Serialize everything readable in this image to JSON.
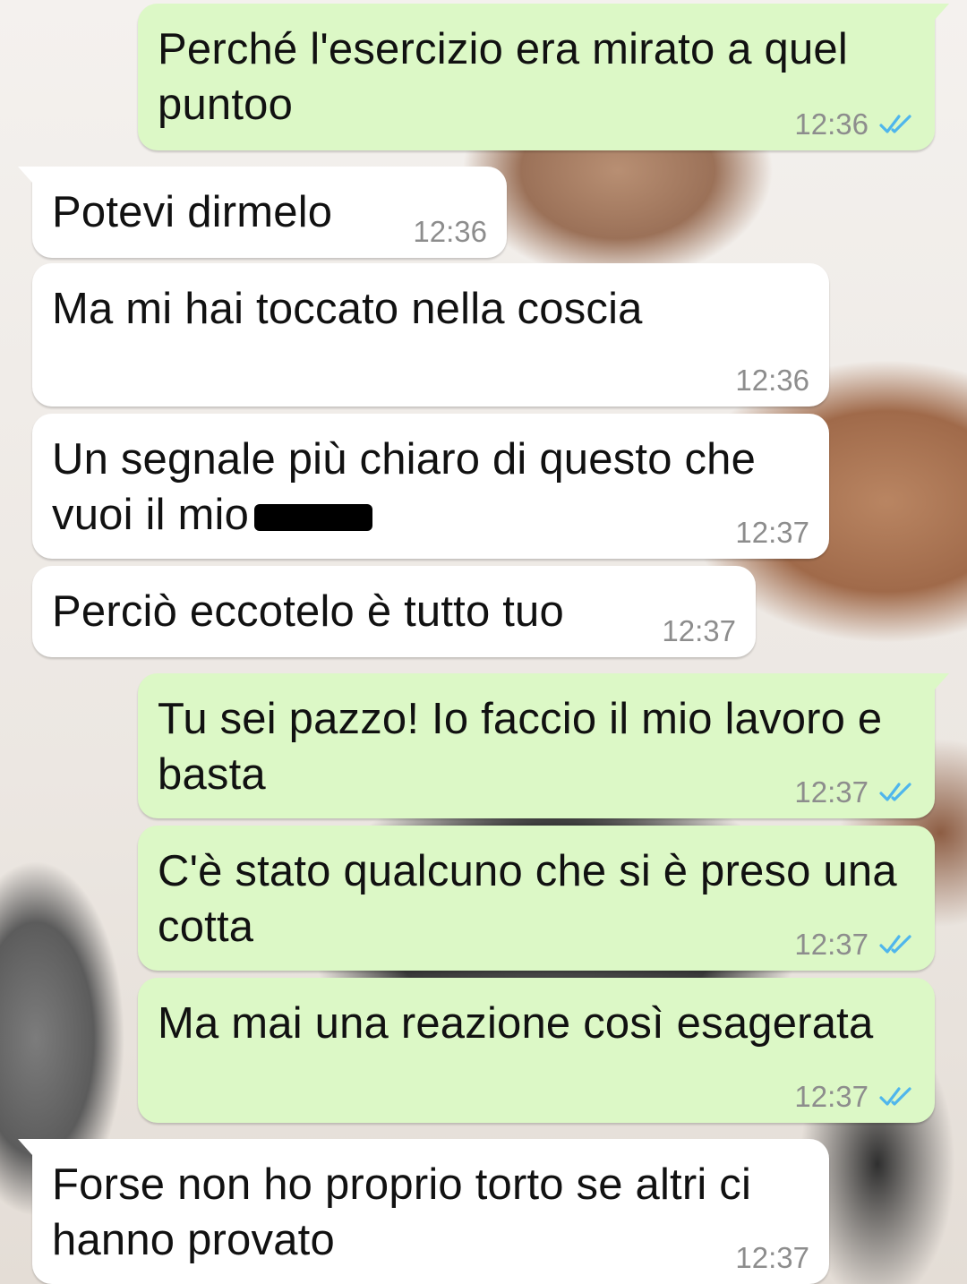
{
  "colors": {
    "incoming_bubble": "#ffffff",
    "outgoing_bubble": "#dcf8c6",
    "time_text": "#8d8d8d",
    "read_ticks": "#4fb6ec"
  },
  "icons": {
    "read_receipt": "double-check-icon",
    "redaction": "redaction-bar"
  },
  "messages": [
    {
      "direction": "out",
      "text": "Perché l'esercizio era mirato a quel puntoo",
      "time": "12:36",
      "status": "read"
    },
    {
      "direction": "in",
      "text": "Potevi dirmelo",
      "time": "12:36"
    },
    {
      "direction": "in",
      "text": "Ma mi hai toccato nella coscia",
      "time": "12:36"
    },
    {
      "direction": "in",
      "text": "Un segnale più chiaro di questo che vuoi il mio",
      "time": "12:37",
      "redacted_word": true
    },
    {
      "direction": "in",
      "text": "Perciò eccotelo è tutto tuo",
      "time": "12:37"
    },
    {
      "direction": "out",
      "text": "Tu sei pazzo! Io faccio il mio lavoro e basta",
      "time": "12:37",
      "status": "read"
    },
    {
      "direction": "out",
      "text": "C'è stato qualcuno che si è preso una cotta",
      "time": "12:37",
      "status": "read"
    },
    {
      "direction": "out",
      "text": "Ma mai una reazione così esagerata",
      "time": "12:37",
      "status": "read"
    },
    {
      "direction": "in",
      "text": "Forse non ho proprio torto se altri ci hanno provato",
      "time": "12:37"
    }
  ]
}
